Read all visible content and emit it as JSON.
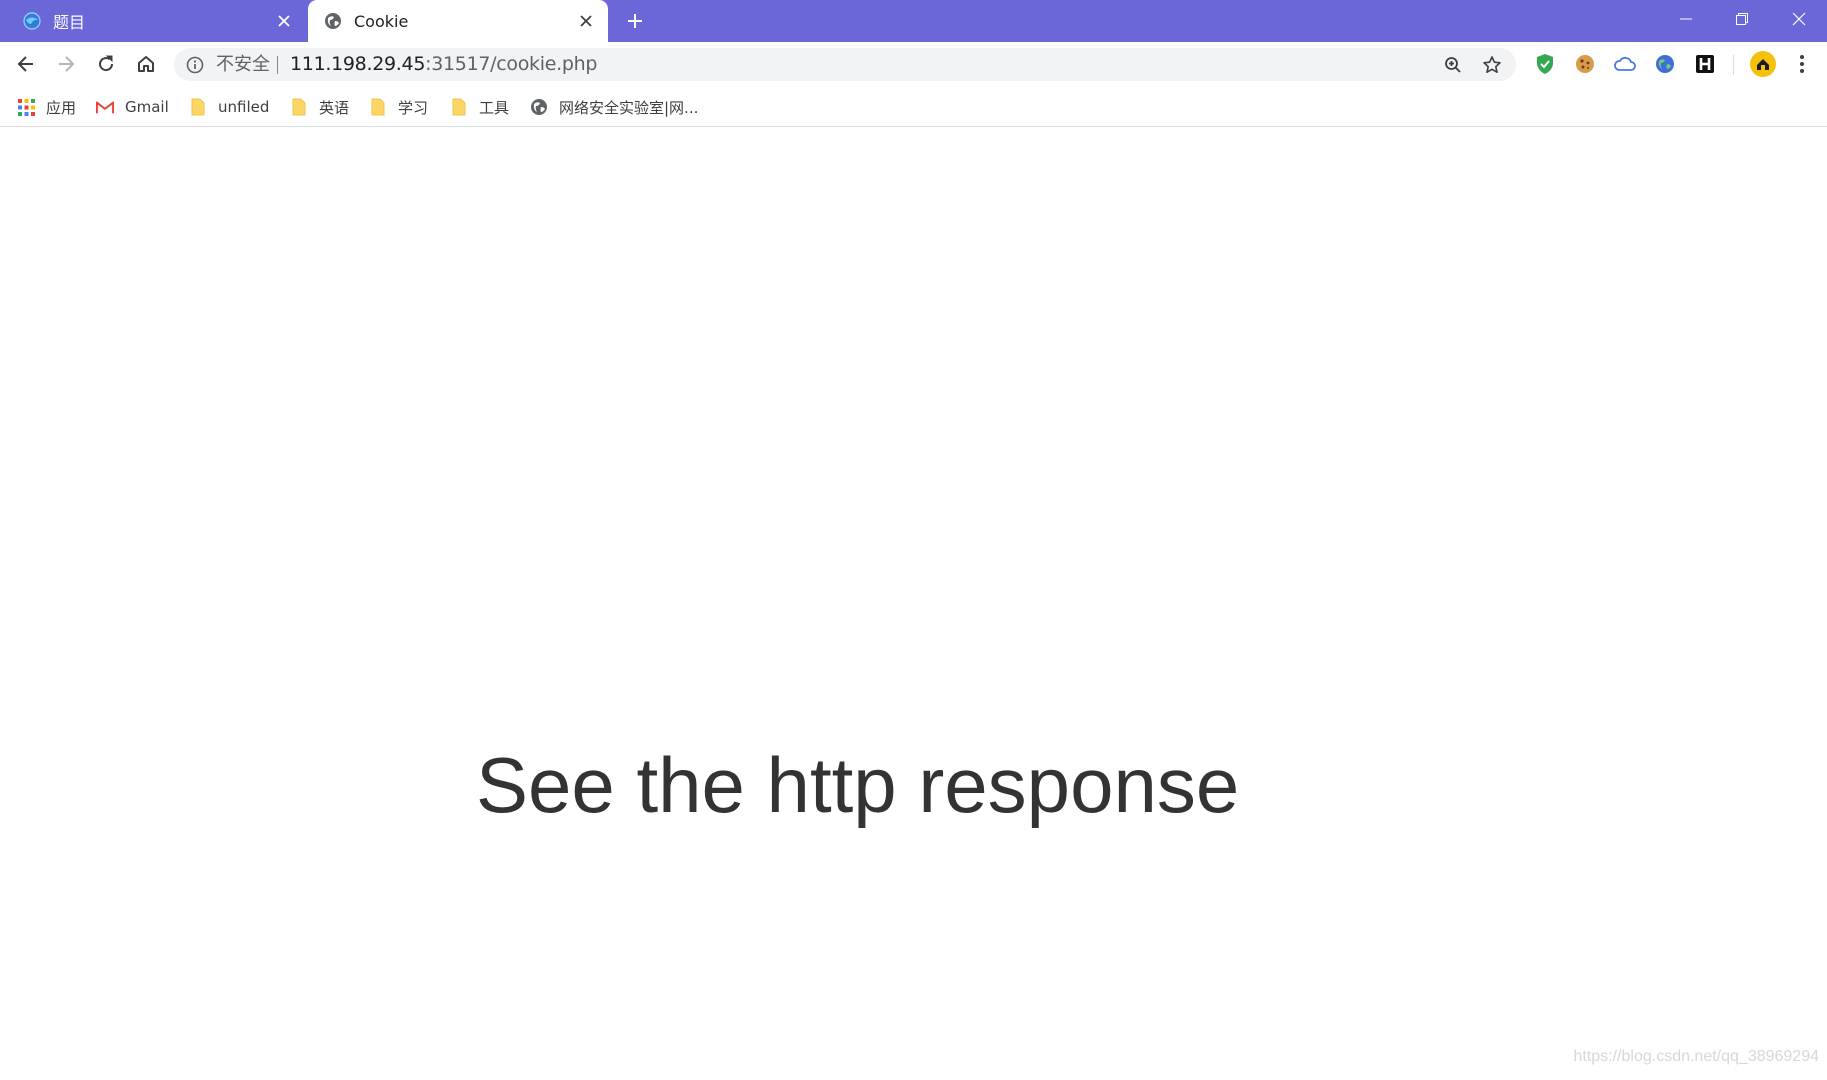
{
  "browser": {
    "accent_color": "#6b67d9",
    "tabs": [
      {
        "title": "题目",
        "active": false,
        "icon": "edge-globe-icon"
      },
      {
        "title": "Cookie",
        "active": true,
        "icon": "globe-icon"
      }
    ],
    "window_controls": [
      "minimize",
      "restore",
      "close"
    ],
    "address_bar": {
      "security_label": "不安全",
      "url_host": "111.198.29.45",
      "url_rest": ":31517/cookie.php"
    },
    "extensions": [
      "shield-check-extension",
      "cookie-extension",
      "cloud-extension",
      "globe-extension",
      "h-extension",
      "profile-avatar"
    ],
    "bookmarks": [
      {
        "label": "应用",
        "icon": "apps-grid-icon"
      },
      {
        "label": "Gmail",
        "icon": "gmail-icon"
      },
      {
        "label": "unfiled",
        "icon": "folder-icon"
      },
      {
        "label": "英语",
        "icon": "folder-icon"
      },
      {
        "label": "学习",
        "icon": "folder-icon"
      },
      {
        "label": "工具",
        "icon": "folder-icon"
      },
      {
        "label": "网络安全实验室|网...",
        "icon": "globe-icon"
      }
    ]
  },
  "page": {
    "headline": "See the http response",
    "watermark": "https://blog.csdn.net/qq_38969294"
  }
}
